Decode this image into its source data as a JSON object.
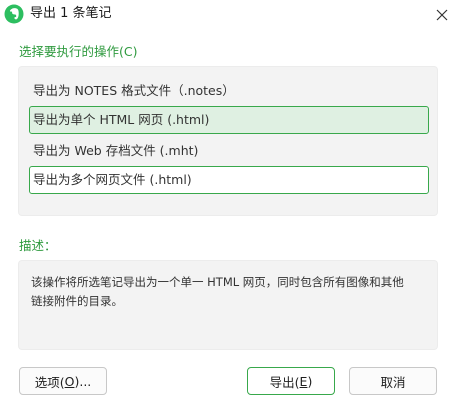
{
  "window": {
    "title": "导出 1 条笔记",
    "app_icon": "evernote-elephant-icon",
    "close_icon": "close-icon"
  },
  "options_section": {
    "heading": "选择要执行的操作(C)",
    "options": [
      {
        "label": "导出为 NOTES 格式文件（.notes）",
        "state": "normal"
      },
      {
        "label": "导出为单个 HTML 网页 (.html)",
        "state": "selected"
      },
      {
        "label": "导出为 Web 存档文件 (.mht)",
        "state": "normal"
      },
      {
        "label": "导出为多个网页文件 (.html)",
        "state": "focused"
      }
    ]
  },
  "description_section": {
    "heading": "描述：",
    "text_line1": "该操作将所选笔记导出为一个单一 HTML 网页，同时包含所有图像和其他",
    "text_line2": "链接附件的目录。"
  },
  "buttons": {
    "options": {
      "prefix": "选项(",
      "key": "O",
      "suffix": ")..."
    },
    "export": {
      "prefix": "导出(",
      "key": "E",
      "suffix": ")"
    },
    "cancel": {
      "label": "取消"
    }
  },
  "colors": {
    "accent_green": "#38a84b",
    "heading_green": "#2f9a3f",
    "selected_bg": "#dff0e2",
    "panel_bg": "#f3f3f3"
  }
}
